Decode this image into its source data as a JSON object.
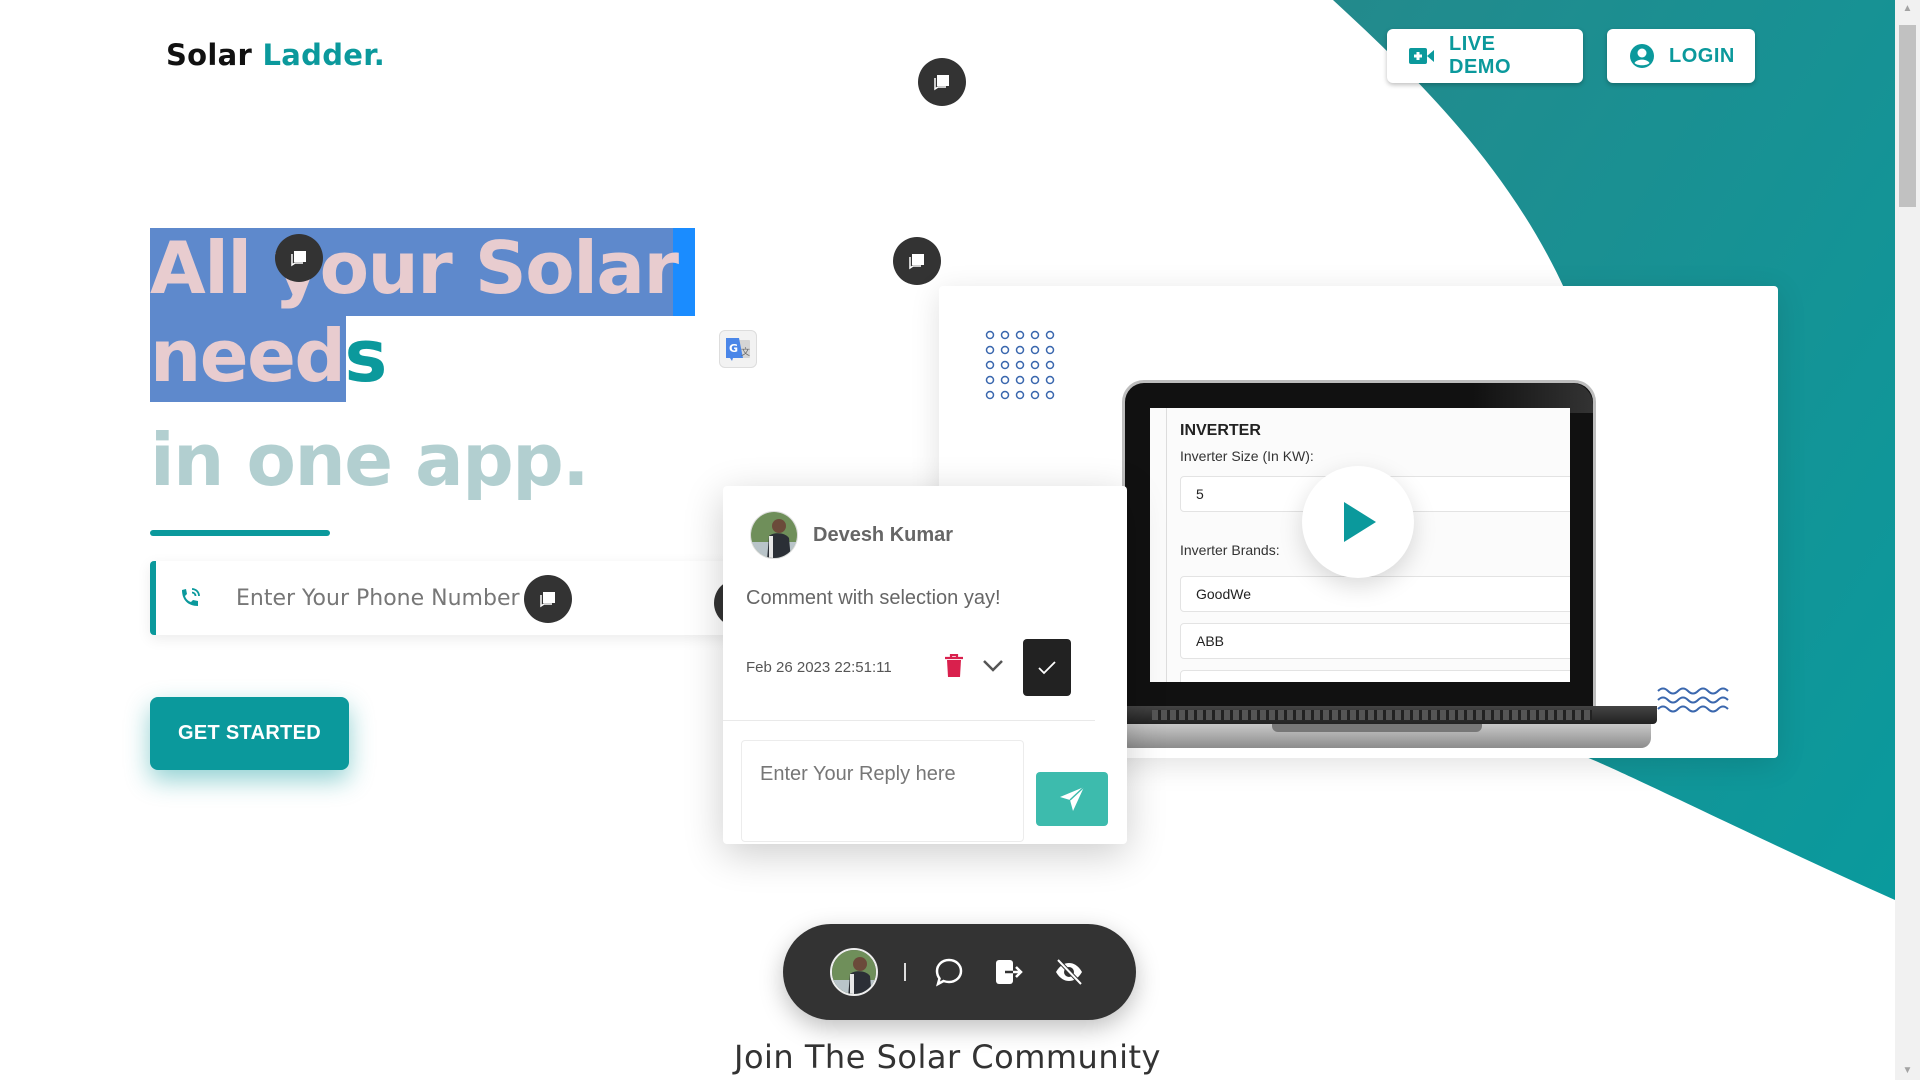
{
  "brand": {
    "name_part1": "Solar",
    "name_part2": "Ladder."
  },
  "header": {
    "live_demo_label": "LIVE DEMO",
    "login_label": "LOGIN"
  },
  "hero": {
    "line1": "All your Solar",
    "line2_selected": "need",
    "line2_rest": "s",
    "line3": "in one app.",
    "phone_placeholder": "Enter Your Phone Number",
    "cta_label": "GET STARTED"
  },
  "video_card": {
    "screen_title": "INVERTER",
    "size_label": "Inverter Size (In KW):",
    "size_value": "5",
    "brands_label": "Inverter Brands:",
    "brands": [
      "GoodWe",
      "ABB"
    ]
  },
  "comment": {
    "author": "Devesh Kumar",
    "text": "Comment with selection yay!",
    "timestamp": "Feb 26 2023 22:51:11",
    "reply_placeholder": "Enter Your Reply here"
  },
  "toolbar": {
    "separator": "|",
    "icons": [
      "comment-icon",
      "exit-icon",
      "hide-icon"
    ]
  },
  "footer": {
    "community_heading": "Join The Solar Community"
  },
  "colors": {
    "accent": "#0b999c",
    "selection": "#5e89cc",
    "delete": "#d9204d",
    "send": "#3dbbad",
    "toolbar_bg": "#333333"
  }
}
